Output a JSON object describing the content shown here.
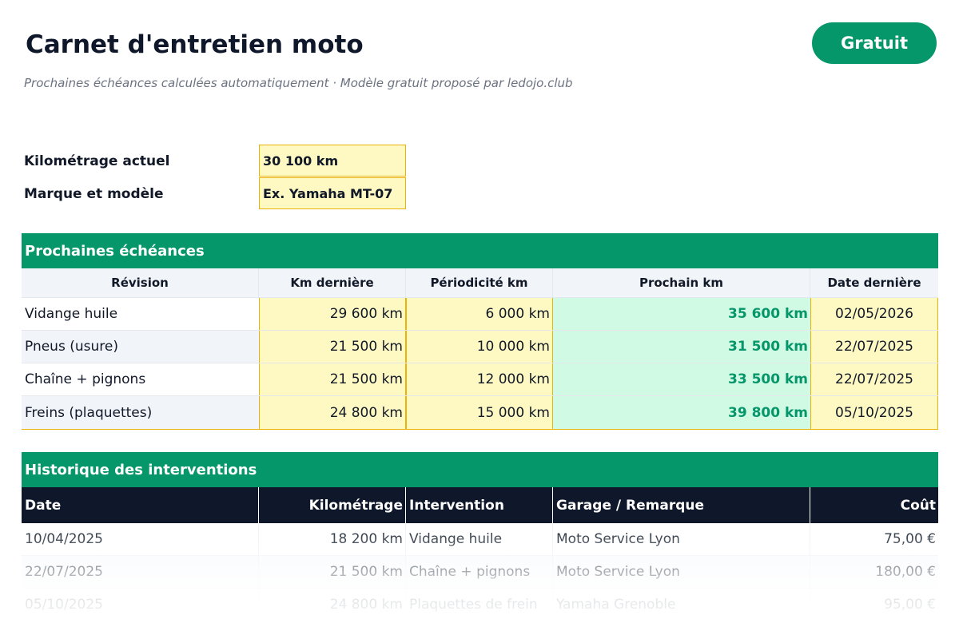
{
  "header": {
    "title": "Carnet d'entretien moto",
    "subtitle": "Prochaines échéances calculées automatiquement · Modèle gratuit proposé par ledojo.club",
    "badge": "Gratuit"
  },
  "info": [
    {
      "label": "Kilométrage actuel",
      "value": "30 100 km"
    },
    {
      "label": "Marque et modèle",
      "value": "Ex. Yamaha MT-07"
    }
  ],
  "echeances": {
    "title": "Prochaines échéances",
    "columns": [
      "Révision",
      "Km dernière",
      "Périodicité km",
      "Prochain km",
      "Date dernière"
    ],
    "rows": [
      {
        "revision": "Vidange huile",
        "km_derniere": "29 600 km",
        "periodicite": "6 000 km",
        "prochain": "35 600 km",
        "date": "02/05/2026"
      },
      {
        "revision": "Pneus (usure)",
        "km_derniere": "21 500 km",
        "periodicite": "10 000 km",
        "prochain": "31 500 km",
        "date": "22/07/2025"
      },
      {
        "revision": "Chaîne + pignons",
        "km_derniere": "21 500 km",
        "periodicite": "12 000 km",
        "prochain": "33 500 km",
        "date": "22/07/2025"
      },
      {
        "revision": "Freins (plaquettes)",
        "km_derniere": "24 800 km",
        "periodicite": "15 000 km",
        "prochain": "39 800 km",
        "date": "05/10/2025"
      }
    ]
  },
  "historique": {
    "title": "Historique des interventions",
    "columns": [
      "Date",
      "Kilométrage",
      "Intervention",
      "Garage / Remarque",
      "Coût"
    ],
    "rows": [
      {
        "date": "10/04/2025",
        "km": "18 200 km",
        "intervention": "Vidange huile",
        "garage": "Moto Service Lyon",
        "cout": "75,00 €"
      },
      {
        "date": "22/07/2025",
        "km": "21 500 km",
        "intervention": "Chaîne + pignons",
        "garage": "Moto Service Lyon",
        "cout": "180,00 €"
      },
      {
        "date": "05/10/2025",
        "km": "24 800 km",
        "intervention": "Plaquettes de frein",
        "garage": "Yamaha Grenoble",
        "cout": "95,00 €"
      }
    ]
  },
  "colors": {
    "accent": "#059669",
    "header_dark": "#0f172a",
    "input_yellow": "#fef9c3",
    "input_border": "#eab308",
    "computed_green": "#d1fae5"
  }
}
